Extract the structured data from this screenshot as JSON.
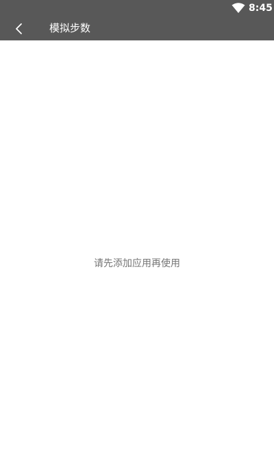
{
  "status_bar": {
    "time": "8:45",
    "wifi_icon": "wifi-icon"
  },
  "app_bar": {
    "title": "模拟步数",
    "back_icon": "chevron-left-icon"
  },
  "main": {
    "empty_message": "请先添加应用再使用"
  },
  "colors": {
    "bar_background": "#585858",
    "page_background": "#ffffff",
    "message_text": "#757575"
  }
}
